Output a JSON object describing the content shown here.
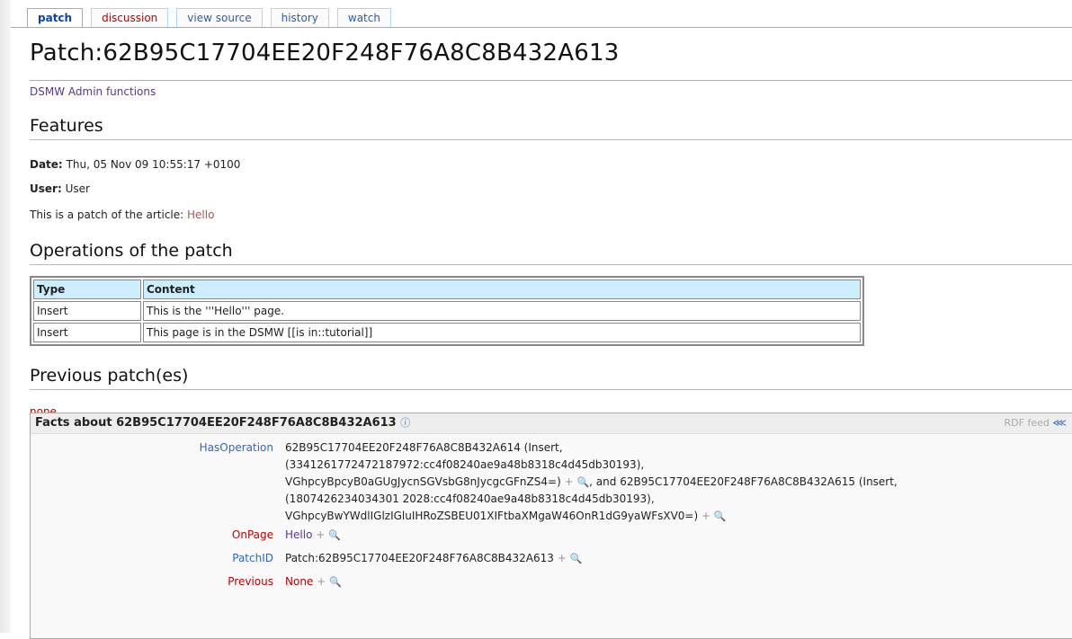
{
  "tabs": [
    {
      "label": "patch",
      "state": "selected"
    },
    {
      "label": "discussion",
      "state": "red"
    },
    {
      "label": "view source",
      "state": ""
    },
    {
      "label": "history",
      "state": ""
    },
    {
      "label": "watch",
      "state": ""
    }
  ],
  "page": {
    "title": "Patch:62B95C17704EE20F248F76A8C8B432A613",
    "admin_link": "DSMW Admin functions"
  },
  "features": {
    "heading": "Features",
    "date_label": "Date:",
    "date_value": "Thu, 05 Nov 09 10:55:17 +0100",
    "user_label": "User:",
    "user_value": "User",
    "article_text": "This is a patch of the article:",
    "article_link": "Hello"
  },
  "operations": {
    "heading": "Operations of the patch",
    "columns": [
      "Type",
      "Content"
    ],
    "rows": [
      [
        "Insert",
        "This is the '''Hello''' page."
      ],
      [
        "Insert",
        "This page is in the DSMW [[is in::tutorial]]"
      ]
    ]
  },
  "previous": {
    "heading": "Previous patch(es)",
    "value": "none"
  },
  "facts": {
    "header_prefix": "Facts about",
    "header_subject": "62B95C17704EE20F248F76A8C8B432A613",
    "rdf_feed": "RDF feed",
    "props": [
      {
        "name": "HasOperation",
        "color": "#3366bb"
      },
      {
        "name": "OnPage",
        "color": "#ba0000"
      },
      {
        "name": "PatchID",
        "color": "#3366bb"
      },
      {
        "name": "Previous",
        "color": "#ba0000"
      }
    ],
    "hasop_line1": "62B95C17704EE20F248F76A8C8B432A614 (Insert,",
    "hasop_line2": "(3341261772472187972:cc4f08240ae9a48b8318c4d45db30193),",
    "hasop_line3a": "VGhpcyBpcyB0aGUgJycnSGVsbG8nJycgcGFnZS4=)",
    "hasop_line3b": ", and 62B95C17704EE20F248F76A8C8B432A615 (Insert,",
    "hasop_line4": "(1807426234034301 2028:cc4f08240ae9a48b8318c4d45db30193),",
    "hasop_line5": "VGhpcyBwYWdlIGlzIGluIHRoZSBEU01XIFtbaXMgaW46OnR1dG9yaWFsXV0=)",
    "onpage_value": "Hello",
    "patchid_value": "Patch:62B95C17704EE20F248F76A8C8B432A613",
    "previous_value": "None",
    "plus": "+"
  }
}
